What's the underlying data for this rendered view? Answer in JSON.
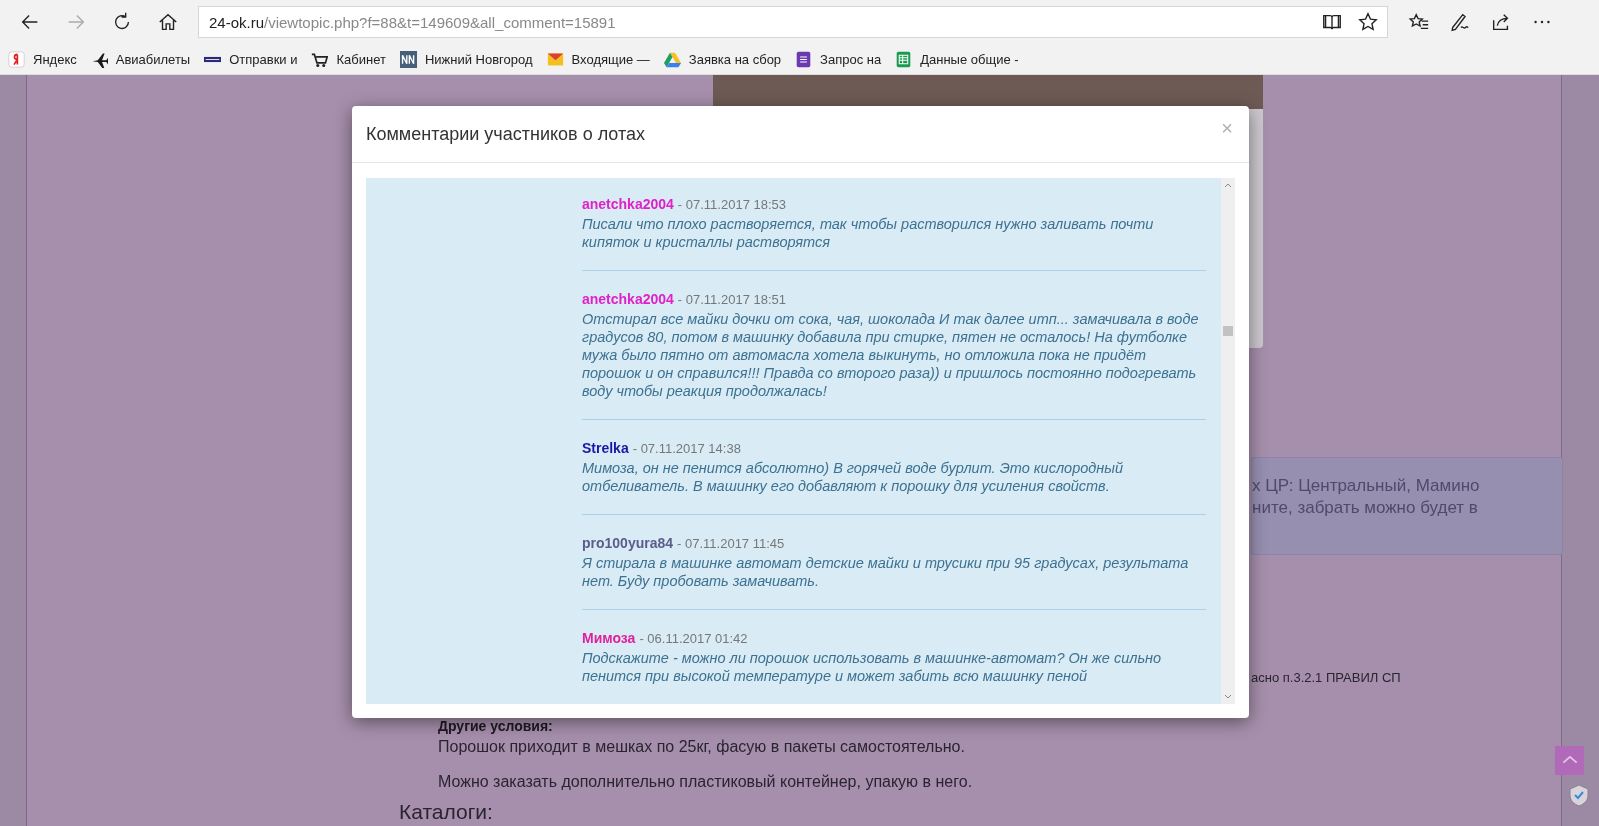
{
  "browser": {
    "nav": [
      {
        "kind": "back",
        "disabled": false
      },
      {
        "kind": "forward",
        "disabled": true
      },
      {
        "kind": "refresh",
        "disabled": false
      },
      {
        "kind": "home",
        "disabled": false
      }
    ],
    "address": {
      "domain": "24-ok.ru",
      "path": "/viewtopic.php?f=88&t=149609&all_comment=15891"
    },
    "address_icons": [
      {
        "kind": "reading"
      },
      {
        "kind": "star"
      }
    ],
    "tools": [
      {
        "kind": "favorites"
      },
      {
        "kind": "pen"
      },
      {
        "kind": "share"
      },
      {
        "kind": "more"
      }
    ],
    "bookmarks": [
      {
        "kind": "yandex",
        "label": "Яндекс"
      },
      {
        "kind": "plane",
        "label": "Авиабилеты"
      },
      {
        "kind": "pek",
        "label": "Отправки и"
      },
      {
        "kind": "cart",
        "label": "Кабинет"
      },
      {
        "kind": "nn",
        "label": "Нижний Новгород"
      },
      {
        "kind": "mail",
        "label": "Входящие —"
      },
      {
        "kind": "drive",
        "label": "Заявка на сбор"
      },
      {
        "kind": "form",
        "label": "Запрос на"
      },
      {
        "kind": "sheet",
        "label": "Данные общие -"
      }
    ]
  },
  "page": {
    "info_lines": [
      "х ЦР: Центральный, Мамино",
      "ните, забрать можно будет в"
    ],
    "rules_text": "асно п.3.2.1 ПРАВИЛ СП",
    "conditions_heading": "Другие условия:",
    "paragraphs": [
      "Порошок приходит в мешках по 25кг, фасую в пакеты самостоятельно.",
      "Можно заказать дополнительно пластиковый контейнер, упакую в него."
    ],
    "catalog_heading": "Каталоги:"
  },
  "modal": {
    "title": "Комментарии участников о лотах",
    "close": "×",
    "comments": [
      {
        "author": "anetchka2004",
        "color": "#e020c8",
        "meta": "- 07.11.2017 18:53",
        "text": "Писали что плохо растворяется, так чтобы растворился нужно заливать почти кипяток и кристаллы растворятся"
      },
      {
        "author": "anetchka2004",
        "color": "#e020c8",
        "meta": "- 07.11.2017 18:51",
        "text": "Отстирал все майки дочки от сока, чая, шоколада И так далее итп... замачивала в воде градусов 80, потом в машинку добавила при стирке, пятен не осталось! На футболке мужа было пятно от автомасла хотела выкинуть, но отложила пока не придёт порошок и он справился!!! Правда со второго раза)) и пришлось постоянно подогревать воду чтобы реакция продолжалась!"
      },
      {
        "author": "Strelka",
        "color": "#1818a8",
        "meta": "- 07.11.2017 14:38",
        "text": "Мимоза, он не пенится абсолютно) В горячей воде бурлит. Это кислородный отбеливатель. В машинку его добавляют к порошку для усиления свойств."
      },
      {
        "author": "pro100yura84",
        "color": "#5c5c8c",
        "meta": "- 07.11.2017 11:45",
        "text": "Я стирала в машинке автомат детские майки и трусики при 95 градусах, результата нет. Буду пробовать замачивать."
      },
      {
        "author": "Мимоза",
        "color": "#e0209c",
        "meta": "- 06.11.2017 01:42",
        "text": "Подскажите - можно ли порошок использовать в машинке-автомат? Он же сильно пенится при высокой температуре и может забить всю машинку пеной"
      }
    ]
  }
}
